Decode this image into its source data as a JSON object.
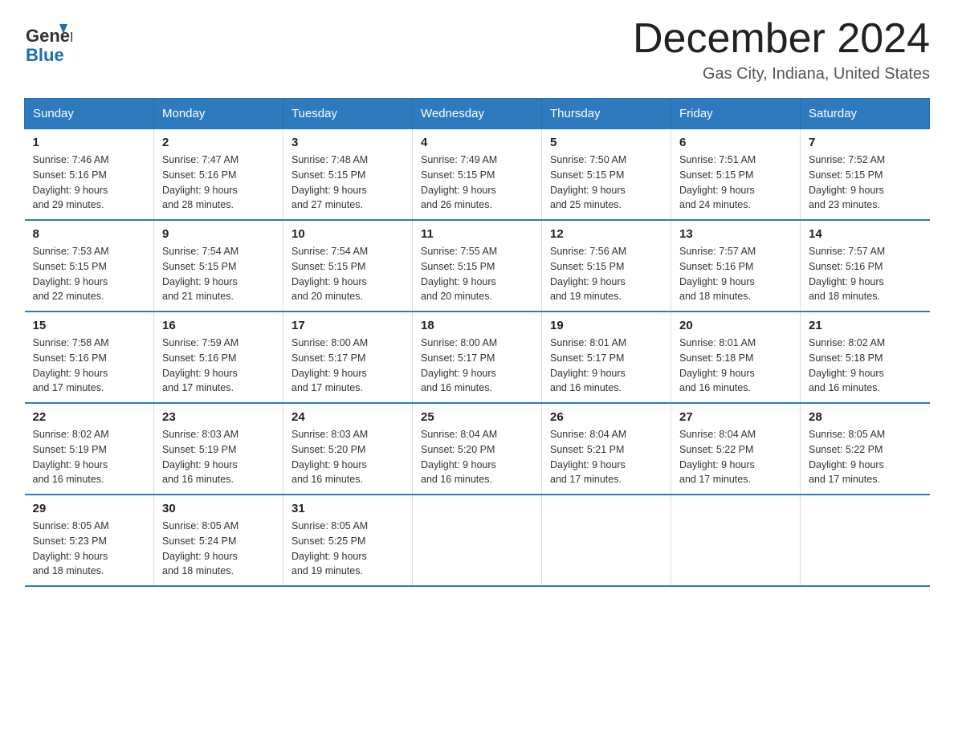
{
  "header": {
    "logo_line1": "General",
    "logo_line2": "Blue",
    "month_title": "December 2024",
    "location": "Gas City, Indiana, United States"
  },
  "days_of_week": [
    "Sunday",
    "Monday",
    "Tuesday",
    "Wednesday",
    "Thursday",
    "Friday",
    "Saturday"
  ],
  "weeks": [
    [
      {
        "day": "1",
        "sunrise": "7:46 AM",
        "sunset": "5:16 PM",
        "daylight": "9 hours and 29 minutes."
      },
      {
        "day": "2",
        "sunrise": "7:47 AM",
        "sunset": "5:16 PM",
        "daylight": "9 hours and 28 minutes."
      },
      {
        "day": "3",
        "sunrise": "7:48 AM",
        "sunset": "5:15 PM",
        "daylight": "9 hours and 27 minutes."
      },
      {
        "day": "4",
        "sunrise": "7:49 AM",
        "sunset": "5:15 PM",
        "daylight": "9 hours and 26 minutes."
      },
      {
        "day": "5",
        "sunrise": "7:50 AM",
        "sunset": "5:15 PM",
        "daylight": "9 hours and 25 minutes."
      },
      {
        "day": "6",
        "sunrise": "7:51 AM",
        "sunset": "5:15 PM",
        "daylight": "9 hours and 24 minutes."
      },
      {
        "day": "7",
        "sunrise": "7:52 AM",
        "sunset": "5:15 PM",
        "daylight": "9 hours and 23 minutes."
      }
    ],
    [
      {
        "day": "8",
        "sunrise": "7:53 AM",
        "sunset": "5:15 PM",
        "daylight": "9 hours and 22 minutes."
      },
      {
        "day": "9",
        "sunrise": "7:54 AM",
        "sunset": "5:15 PM",
        "daylight": "9 hours and 21 minutes."
      },
      {
        "day": "10",
        "sunrise": "7:54 AM",
        "sunset": "5:15 PM",
        "daylight": "9 hours and 20 minutes."
      },
      {
        "day": "11",
        "sunrise": "7:55 AM",
        "sunset": "5:15 PM",
        "daylight": "9 hours and 20 minutes."
      },
      {
        "day": "12",
        "sunrise": "7:56 AM",
        "sunset": "5:15 PM",
        "daylight": "9 hours and 19 minutes."
      },
      {
        "day": "13",
        "sunrise": "7:57 AM",
        "sunset": "5:16 PM",
        "daylight": "9 hours and 18 minutes."
      },
      {
        "day": "14",
        "sunrise": "7:57 AM",
        "sunset": "5:16 PM",
        "daylight": "9 hours and 18 minutes."
      }
    ],
    [
      {
        "day": "15",
        "sunrise": "7:58 AM",
        "sunset": "5:16 PM",
        "daylight": "9 hours and 17 minutes."
      },
      {
        "day": "16",
        "sunrise": "7:59 AM",
        "sunset": "5:16 PM",
        "daylight": "9 hours and 17 minutes."
      },
      {
        "day": "17",
        "sunrise": "8:00 AM",
        "sunset": "5:17 PM",
        "daylight": "9 hours and 17 minutes."
      },
      {
        "day": "18",
        "sunrise": "8:00 AM",
        "sunset": "5:17 PM",
        "daylight": "9 hours and 16 minutes."
      },
      {
        "day": "19",
        "sunrise": "8:01 AM",
        "sunset": "5:17 PM",
        "daylight": "9 hours and 16 minutes."
      },
      {
        "day": "20",
        "sunrise": "8:01 AM",
        "sunset": "5:18 PM",
        "daylight": "9 hours and 16 minutes."
      },
      {
        "day": "21",
        "sunrise": "8:02 AM",
        "sunset": "5:18 PM",
        "daylight": "9 hours and 16 minutes."
      }
    ],
    [
      {
        "day": "22",
        "sunrise": "8:02 AM",
        "sunset": "5:19 PM",
        "daylight": "9 hours and 16 minutes."
      },
      {
        "day": "23",
        "sunrise": "8:03 AM",
        "sunset": "5:19 PM",
        "daylight": "9 hours and 16 minutes."
      },
      {
        "day": "24",
        "sunrise": "8:03 AM",
        "sunset": "5:20 PM",
        "daylight": "9 hours and 16 minutes."
      },
      {
        "day": "25",
        "sunrise": "8:04 AM",
        "sunset": "5:20 PM",
        "daylight": "9 hours and 16 minutes."
      },
      {
        "day": "26",
        "sunrise": "8:04 AM",
        "sunset": "5:21 PM",
        "daylight": "9 hours and 17 minutes."
      },
      {
        "day": "27",
        "sunrise": "8:04 AM",
        "sunset": "5:22 PM",
        "daylight": "9 hours and 17 minutes."
      },
      {
        "day": "28",
        "sunrise": "8:05 AM",
        "sunset": "5:22 PM",
        "daylight": "9 hours and 17 minutes."
      }
    ],
    [
      {
        "day": "29",
        "sunrise": "8:05 AM",
        "sunset": "5:23 PM",
        "daylight": "9 hours and 18 minutes."
      },
      {
        "day": "30",
        "sunrise": "8:05 AM",
        "sunset": "5:24 PM",
        "daylight": "9 hours and 18 minutes."
      },
      {
        "day": "31",
        "sunrise": "8:05 AM",
        "sunset": "5:25 PM",
        "daylight": "9 hours and 19 minutes."
      },
      null,
      null,
      null,
      null
    ]
  ],
  "labels": {
    "sunrise": "Sunrise:",
    "sunset": "Sunset:",
    "daylight": "Daylight:"
  }
}
